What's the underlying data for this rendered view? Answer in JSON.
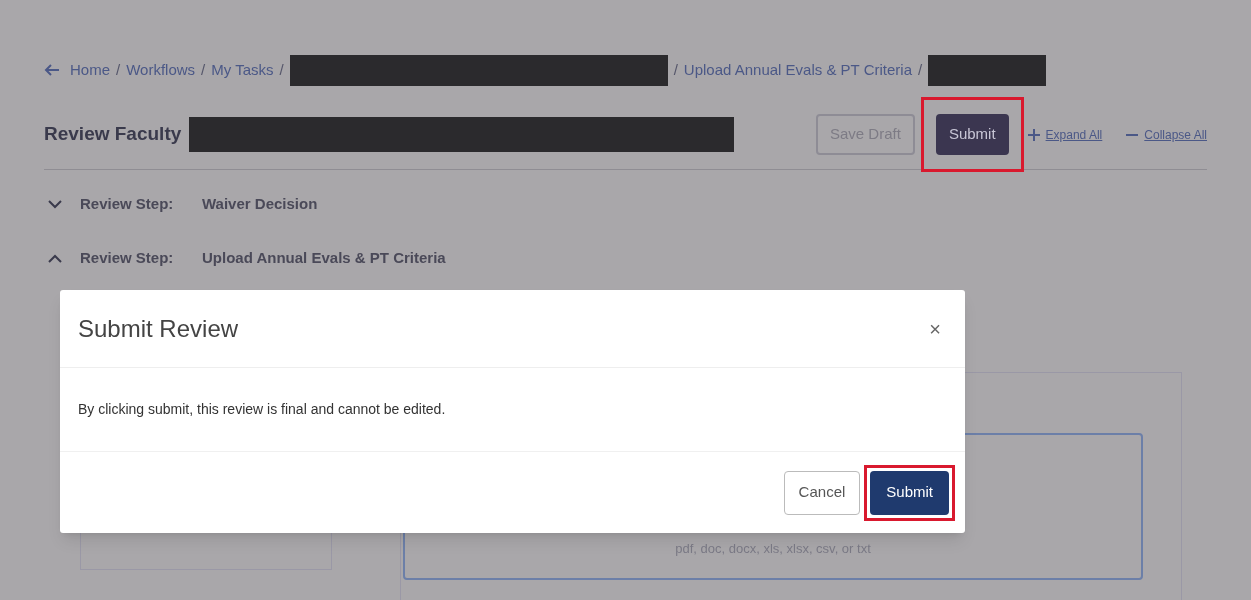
{
  "breadcrumbs": {
    "separator": "/",
    "items": [
      {
        "kind": "link",
        "label": "Home"
      },
      {
        "kind": "link",
        "label": "Workflows"
      },
      {
        "kind": "link",
        "label": "My Tasks"
      },
      {
        "kind": "redacted"
      },
      {
        "kind": "link",
        "label": "Upload Annual Evals & PT Criteria"
      },
      {
        "kind": "redacted"
      }
    ]
  },
  "header": {
    "title": "Review Faculty",
    "title_redacted": true,
    "buttons": [
      {
        "kind": "secondary",
        "label": "Save Draft",
        "highlighted": false
      },
      {
        "kind": "primary",
        "label": "Submit",
        "highlighted": true
      }
    ],
    "links": [
      {
        "kind": "expand",
        "label": "Expand All"
      },
      {
        "kind": "collapse",
        "label": "Collapse All"
      }
    ]
  },
  "steps": [
    {
      "label": "Review Step:",
      "value": "Waiver Decision",
      "expanded": false
    },
    {
      "label": "Review Step:",
      "value": "Upload Annual Evals & PT Criteria",
      "expanded": true
    }
  ],
  "upload": {
    "hint": "pdf, doc, docx, xls, xlsx, csv, or txt"
  },
  "modal": {
    "title": "Submit Review",
    "close": "×",
    "message": "By clicking submit, this review is final and cannot be edited.",
    "buttons": [
      {
        "kind": "secondary",
        "label": "Cancel",
        "highlighted": false
      },
      {
        "kind": "primary",
        "label": "Submit",
        "highlighted": true
      }
    ]
  }
}
